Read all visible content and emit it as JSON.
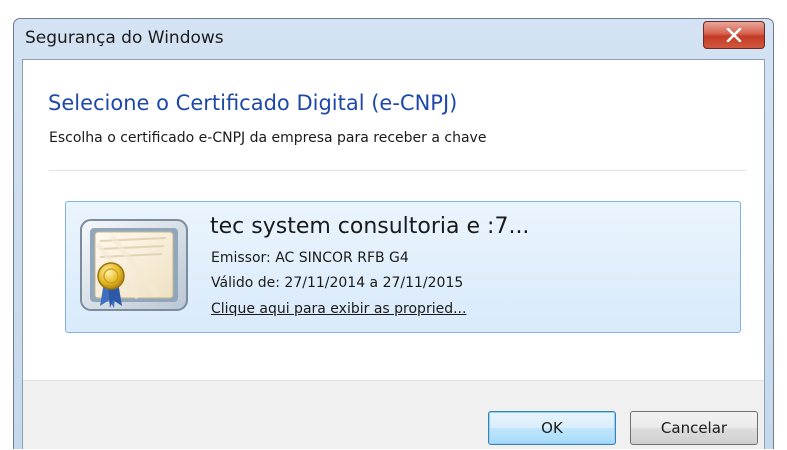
{
  "window": {
    "title": "Segurança do Windows",
    "close_label": "X"
  },
  "dialog": {
    "heading": "Selecione o Certificado Digital (e-CNPJ)",
    "subheading": "Escolha o certificado e-CNPJ da empresa para receber a chave"
  },
  "certificate": {
    "name": "tec system consultoria e :7...",
    "issuer": "Emissor: AC SINCOR RFB G4",
    "validity": "Válido de: 27/11/2014 a 27/11/2015",
    "properties_link": "Clique aqui para exibir as propried...",
    "icon": "certificate-icon"
  },
  "buttons": {
    "ok": "OK",
    "cancel": "Cancelar"
  },
  "colors": {
    "heading": "#1f49a8",
    "selection_border": "#7fb2e5",
    "close_button": "#c43b25"
  }
}
